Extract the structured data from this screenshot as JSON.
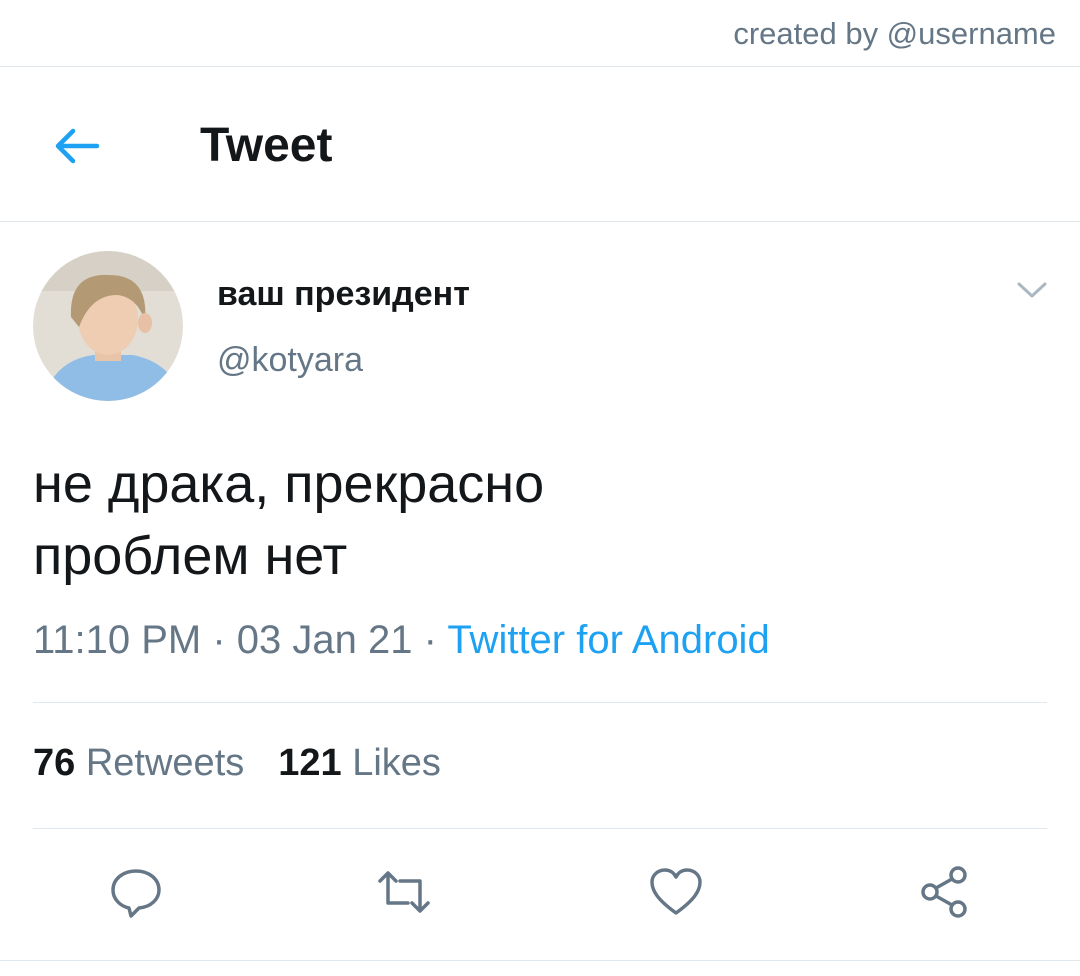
{
  "watermark": "created by @username",
  "header": {
    "title": "Tweet",
    "back_icon": "arrow-left-icon"
  },
  "tweet": {
    "display_name": "ваш президент",
    "handle": "@kotyara",
    "text_lines": [
      "не драка, прекрасно",
      "проблем нет"
    ],
    "time": "11:10 PM",
    "date": "03 Jan 21",
    "separator": " · ",
    "source": "Twitter for Android",
    "retweets_count": "76",
    "retweets_label": "Retweets",
    "likes_count": "121",
    "likes_label": "Likes"
  },
  "actions": [
    "reply-icon",
    "retweet-icon",
    "like-icon",
    "share-icon"
  ],
  "colors": {
    "accent": "#1da1f2",
    "text": "#14171a",
    "muted": "#657786",
    "divider": "#e1e8ed"
  }
}
